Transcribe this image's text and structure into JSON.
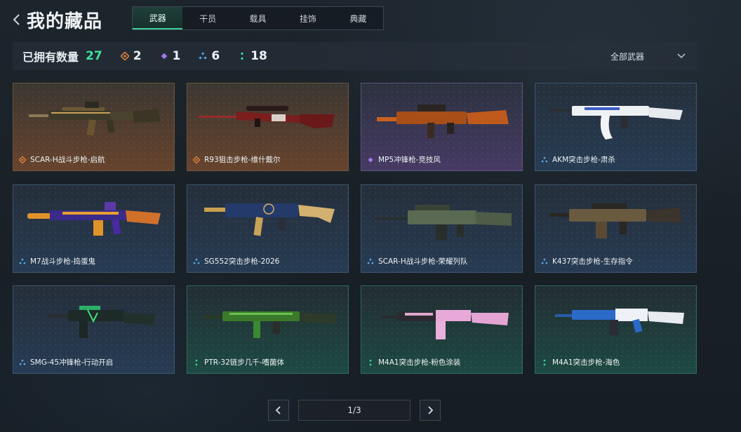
{
  "header": {
    "title": "我的藏品",
    "tabs": [
      {
        "label": "武器",
        "active": true
      },
      {
        "label": "干员",
        "active": false
      },
      {
        "label": "载具",
        "active": false
      },
      {
        "label": "挂饰",
        "active": false
      },
      {
        "label": "典藏",
        "active": false
      }
    ]
  },
  "stats": {
    "owned_label": "已拥有数量",
    "owned_total": "27",
    "rarity_counts": [
      {
        "icon": "orange-diamond-icon",
        "color": "#e0823e",
        "count": "2"
      },
      {
        "icon": "purple-diamond-icon",
        "color": "#a778ee",
        "count": "1"
      },
      {
        "icon": "blue-triple-diamond-icon",
        "color": "#5aa7e8",
        "count": "6"
      },
      {
        "icon": "green-double-diamond-icon",
        "color": "#35d69a",
        "count": "18"
      }
    ],
    "filter_label": "全部武器"
  },
  "items": [
    {
      "name": "SCAR-H战斗步枪-启航",
      "rarity": "orange"
    },
    {
      "name": "R93狙击步枪-维什戴尔",
      "rarity": "orange"
    },
    {
      "name": "MP5冲锋枪-竞技风",
      "rarity": "purple"
    },
    {
      "name": "AKM突击步枪-肃杀",
      "rarity": "blue"
    },
    {
      "name": "M7战斗步枪-捣蛋鬼",
      "rarity": "blue"
    },
    {
      "name": "SG552突击步枪-2026",
      "rarity": "blue"
    },
    {
      "name": "SCAR-H战斗步枪-荣耀列队",
      "rarity": "blue"
    },
    {
      "name": "K437突击步枪-生存指令",
      "rarity": "blue"
    },
    {
      "name": "SMG-45冲锋枪-行动开启",
      "rarity": "blue"
    },
    {
      "name": "PTR-32链步几千-嗜菌体",
      "rarity": "green"
    },
    {
      "name": "M4A1突击步枪-粉色涂装",
      "rarity": "green"
    },
    {
      "name": "M4A1突击步枪-海色",
      "rarity": "green"
    }
  ],
  "pagination": {
    "page_text": "1/3"
  },
  "colors": {
    "accent_green": "#3ee09b",
    "orange": "#e0823e",
    "purple": "#a778ee",
    "blue": "#5aa7e8",
    "green": "#35d69a"
  }
}
